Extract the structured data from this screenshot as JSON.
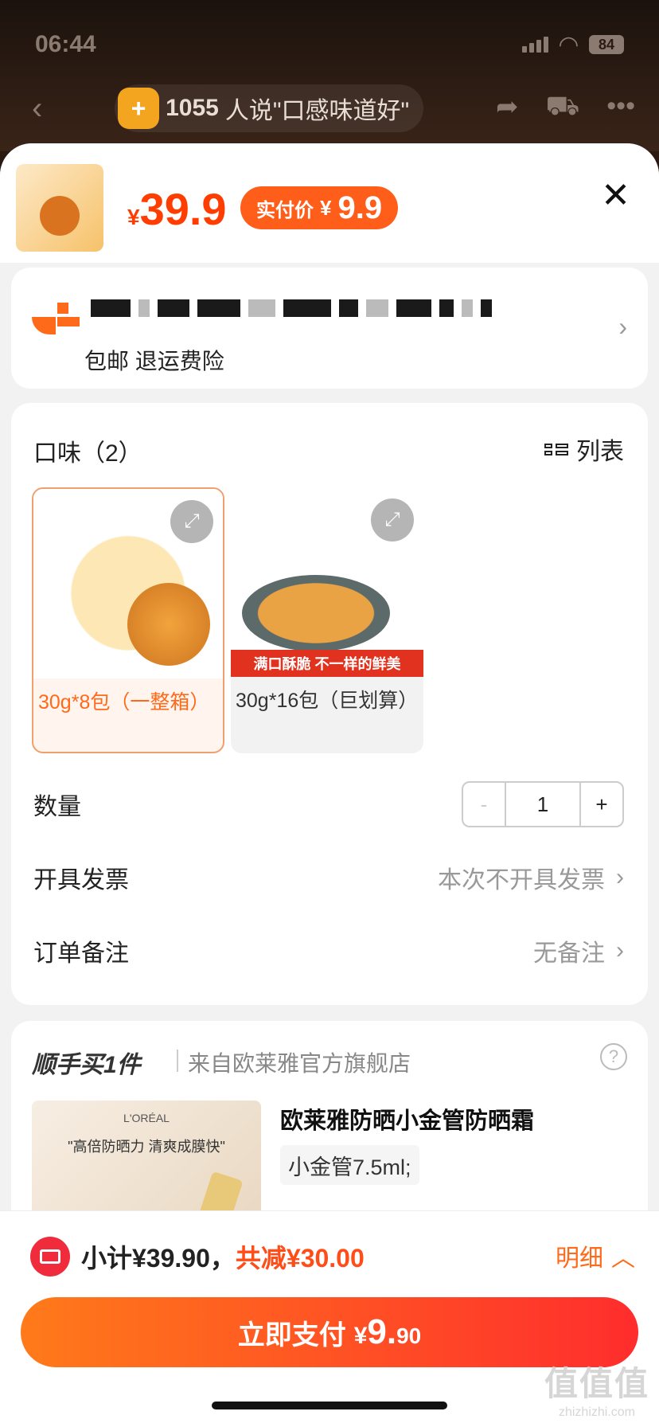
{
  "status_bar": {
    "time": "06:44",
    "battery": "84"
  },
  "header": {
    "review_badge_count": "1055",
    "review_badge_text": "人说\"口感味道好\""
  },
  "product": {
    "currency": "¥",
    "price": "39.9",
    "paid_label": "实付价",
    "paid_currency": "¥",
    "paid_price": "9.9"
  },
  "address": {
    "shipping_text": "包邮 退运费险"
  },
  "options": {
    "flavor_title": "口味（2）",
    "list_toggle": "列表",
    "skus": [
      {
        "label": "30g*8包（一整箱）",
        "selected": true
      },
      {
        "label": "30g*16包（巨划算）",
        "selected": false,
        "banner": "满口酥脆 不一样的鲜美"
      }
    ],
    "quantity_label": "数量",
    "quantity_minus": "-",
    "quantity_value": "1",
    "quantity_plus": "+",
    "invoice_label": "开具发票",
    "invoice_value": "本次不开具发票",
    "note_label": "订单备注",
    "note_value": "无备注"
  },
  "upsell": {
    "title": "顺手买1件",
    "shop": "来自欧莱雅官方旗舰店",
    "image_brand": "L'ORÉAL",
    "image_slogan": "\"高倍防晒力 清爽成膜快\"",
    "name": "欧莱雅防晒小金管防晒霜",
    "spec": "小金管7.5ml;"
  },
  "footer": {
    "subtotal": "小计¥39.90，",
    "discount": "共减¥30.00",
    "detail_label": "明细",
    "pay_label": "立即支付",
    "pay_currency": "¥",
    "pay_amount_int": "9.",
    "pay_amount_dec": "90"
  },
  "watermark": {
    "logo": "值值值",
    "site": "zhizhizhi.com"
  },
  "colors": {
    "accent": "#ff6a1a",
    "price_red": "#ff3d00",
    "pay_gradient_start": "#ff7a1a",
    "pay_gradient_end": "#ff2d2d"
  }
}
